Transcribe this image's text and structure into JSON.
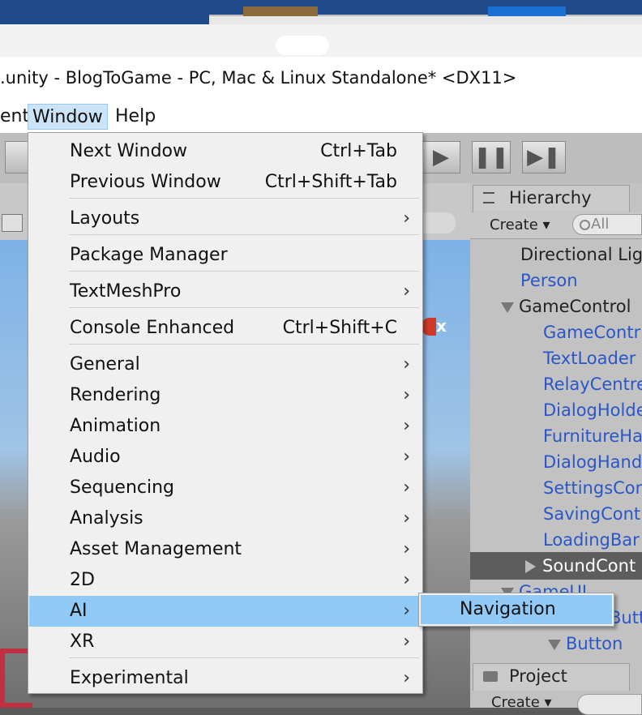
{
  "window": {
    "title": ".unity - BlogToGame - PC, Mac & Linux Standalone* <DX11>"
  },
  "menubar": {
    "items": [
      {
        "label": "ent"
      },
      {
        "label": "Window"
      },
      {
        "label": "Help"
      }
    ]
  },
  "window_menu": {
    "items": [
      {
        "label": "Next Window",
        "shortcut": "Ctrl+Tab"
      },
      {
        "label": "Previous Window",
        "shortcut": "Ctrl+Shift+Tab"
      },
      {
        "label": "Layouts",
        "submenu": true
      },
      {
        "label": "Package Manager"
      },
      {
        "label": "TextMeshPro",
        "submenu": true
      },
      {
        "label": "Console Enhanced",
        "shortcut": "Ctrl+Shift+C"
      },
      {
        "label": "General",
        "submenu": true
      },
      {
        "label": "Rendering",
        "submenu": true
      },
      {
        "label": "Animation",
        "submenu": true
      },
      {
        "label": "Audio",
        "submenu": true
      },
      {
        "label": "Sequencing",
        "submenu": true
      },
      {
        "label": "Analysis",
        "submenu": true
      },
      {
        "label": "Asset Management",
        "submenu": true
      },
      {
        "label": "2D",
        "submenu": true
      },
      {
        "label": "AI",
        "submenu": true,
        "highlighted": true
      },
      {
        "label": "XR",
        "submenu": true
      },
      {
        "label": "Experimental",
        "submenu": true
      }
    ],
    "arrow_glyph": "›"
  },
  "ai_submenu": {
    "items": [
      {
        "label": "Navigation",
        "highlighted": true
      }
    ]
  },
  "hierarchy": {
    "tab_label": "Hierarchy",
    "create_label": "Create ▾",
    "search_placeholder": "All",
    "rows": [
      {
        "label": "Directional Lig"
      },
      {
        "label": "Person"
      },
      {
        "label": "GameControl"
      },
      {
        "label": "GameContr"
      },
      {
        "label": "TextLoader"
      },
      {
        "label": "RelayCentre"
      },
      {
        "label": "DialogHolde"
      },
      {
        "label": "FurnitureHa"
      },
      {
        "label": "DialogHand"
      },
      {
        "label": "SettingsCon"
      },
      {
        "label": "SavingCont"
      },
      {
        "label": "LoadingBar"
      },
      {
        "label": "SoundCont"
      },
      {
        "label": "GameUI"
      },
      {
        "label": "Butto"
      },
      {
        "label": "Button"
      }
    ]
  },
  "project": {
    "tab_label": "Project",
    "create_label": "Create ▾"
  },
  "toolbar": {
    "play_icon": "▶",
    "pause_icon": "❚❚",
    "step_icon": "▶❚"
  },
  "colors": {
    "menu_highlight": "#91c9f7",
    "menu_bg": "#f0f0f0",
    "hierarchy_blue": "#2a56c8",
    "hierarchy_selected": "#5d5d5d"
  }
}
